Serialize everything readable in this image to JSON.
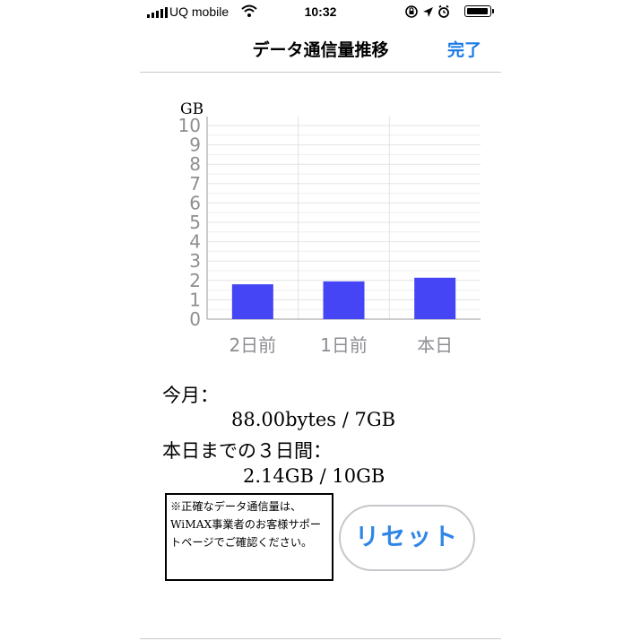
{
  "status_bar": {
    "carrier": "UQ mobile",
    "time": "10:32",
    "icons": [
      "signal-icon",
      "wifi-icon",
      "rotation-lock-icon",
      "location-icon",
      "alarm-icon",
      "battery-icon"
    ]
  },
  "nav": {
    "title": "データ通信量推移",
    "done_label": "完了"
  },
  "colors": {
    "accent": "#1a7ae8",
    "bar": "#4545f5"
  },
  "chart_data": {
    "type": "bar",
    "ylabel": "GB",
    "ylim": [
      0,
      10
    ],
    "yticks": [
      "0",
      "1",
      "2",
      "3",
      "4",
      "5",
      "6",
      "7",
      "8",
      "9",
      "10"
    ],
    "categories": [
      "2日前",
      "1日前",
      "本日"
    ],
    "values": [
      1.8,
      1.95,
      2.14
    ],
    "grid": true
  },
  "usage": {
    "month_label": "今月：",
    "month_value": "88.00bytes / 7GB",
    "three_day_label": "本日までの３日間：",
    "three_day_value": "2.14GB / 10GB"
  },
  "notice": {
    "text": "※正確なデータ通信量は、WiMAX事業者のお客様サポートページでご確認ください。"
  },
  "reset_label": "リセット"
}
